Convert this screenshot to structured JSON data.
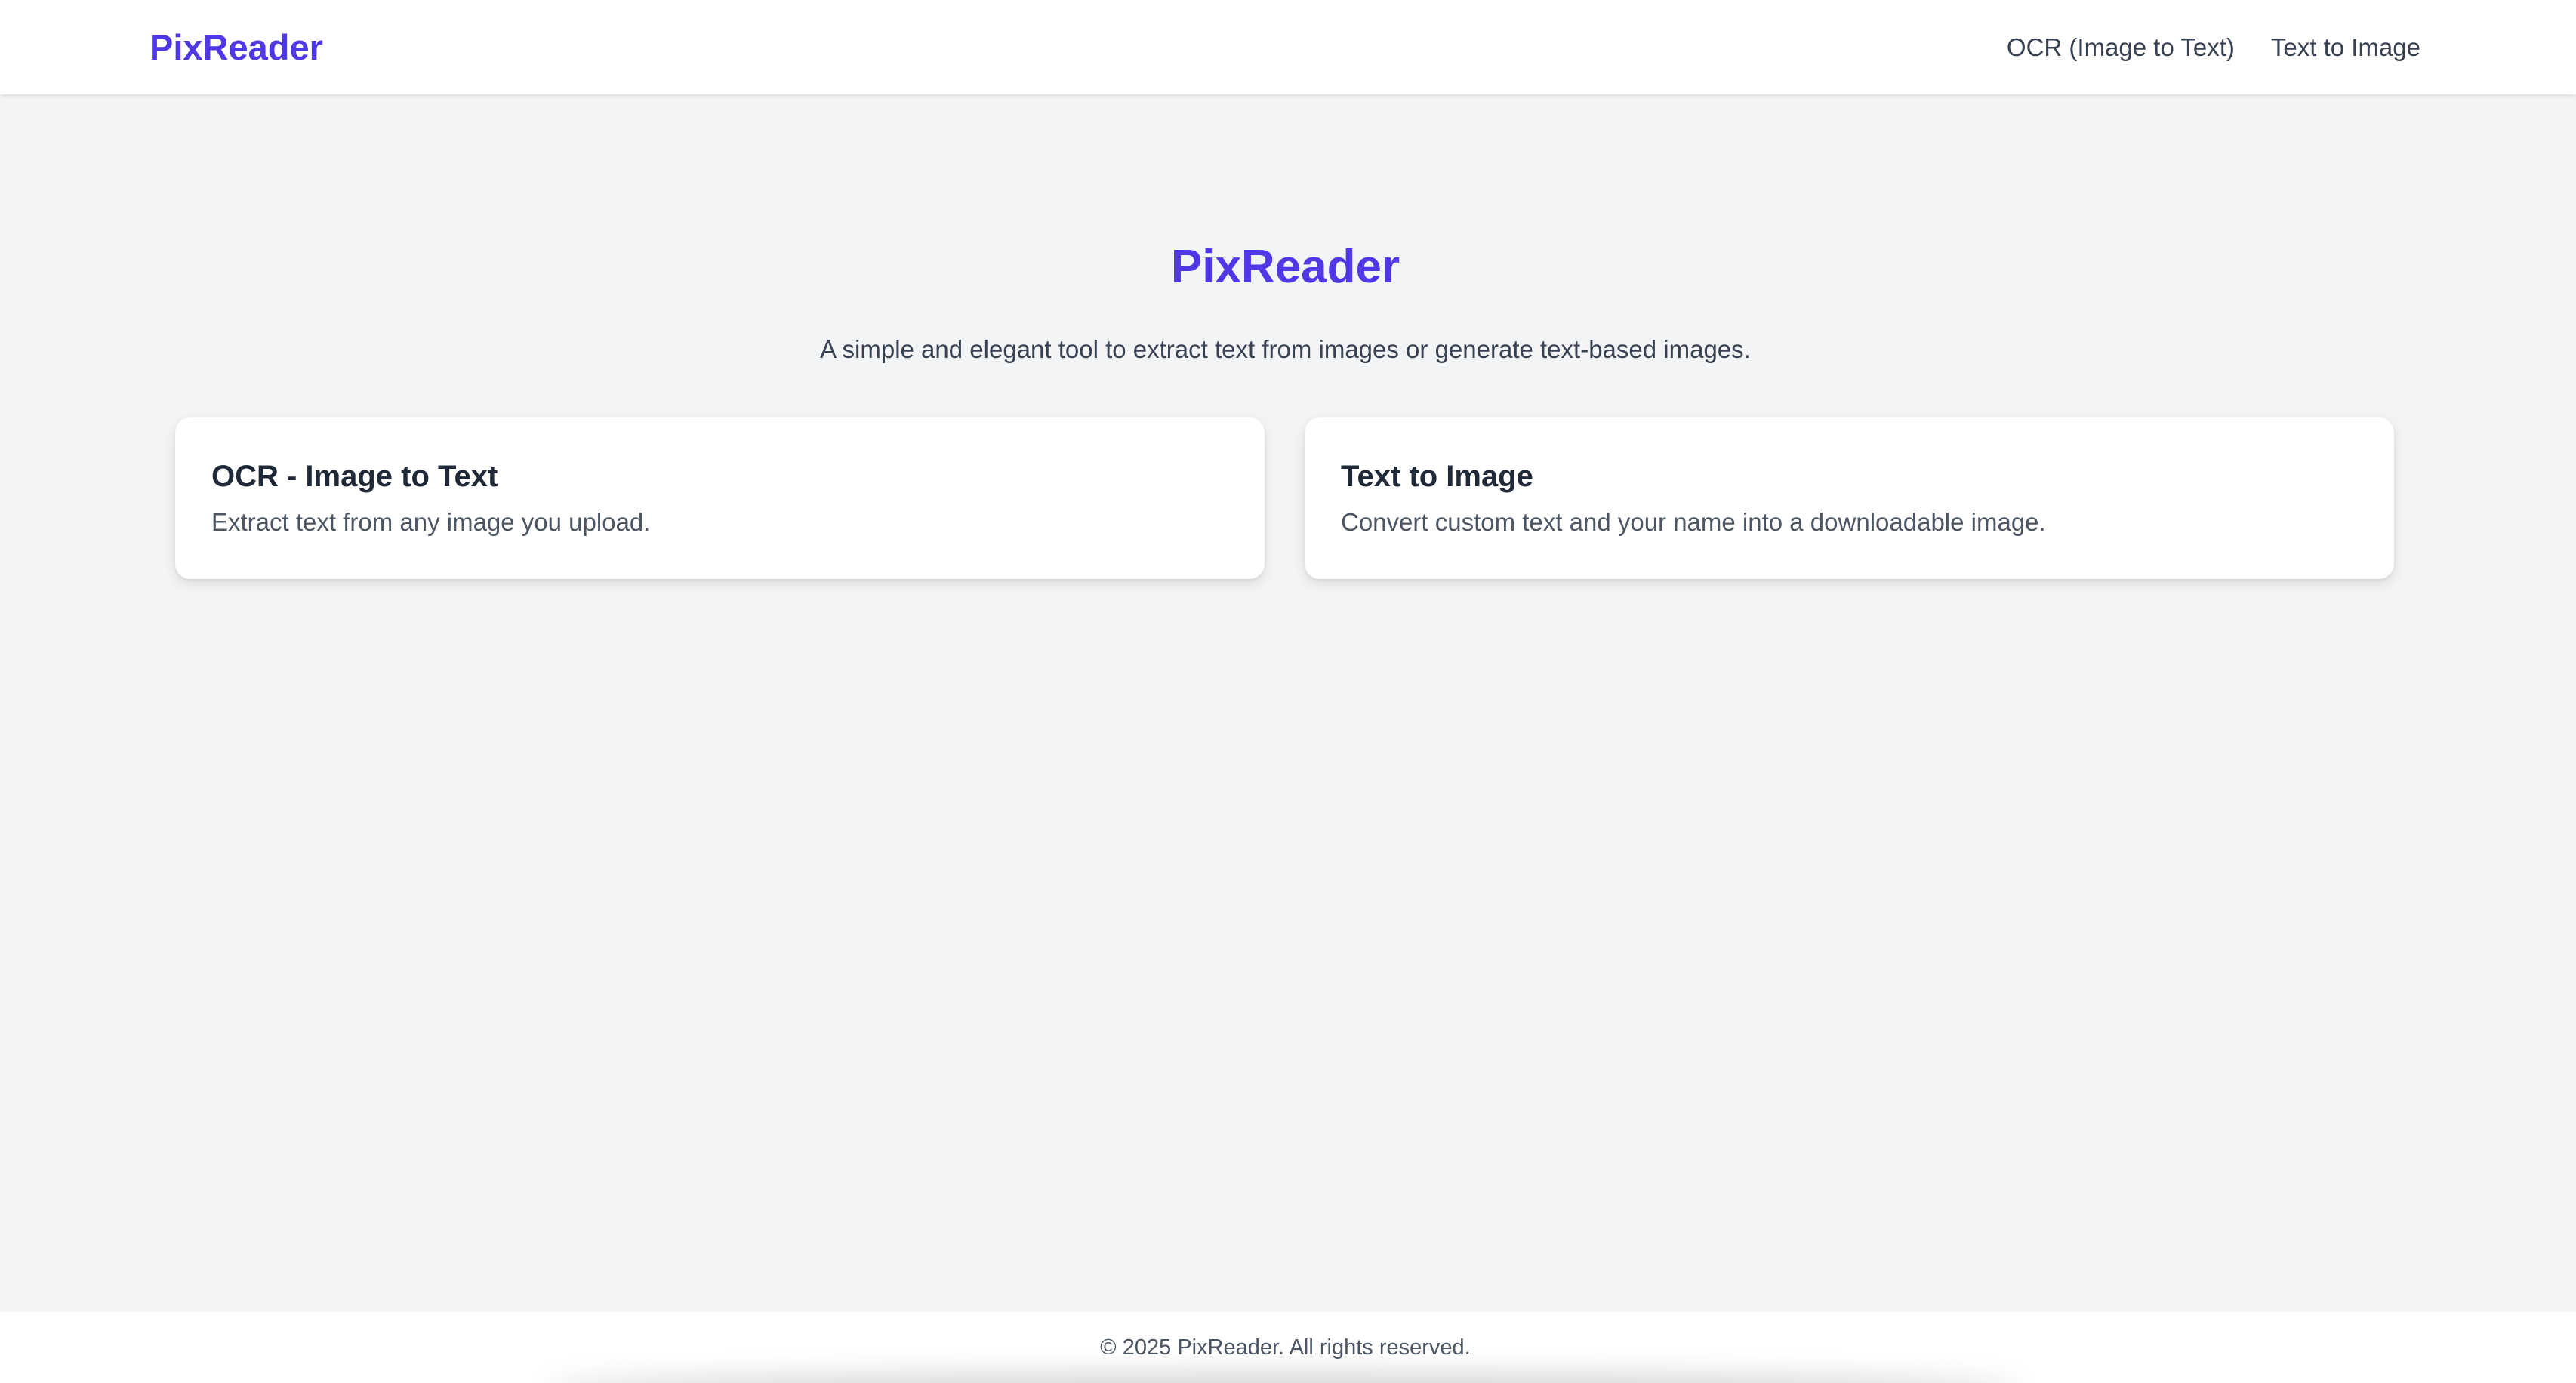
{
  "navbar": {
    "brand": "PixReader",
    "links": [
      {
        "label": "OCR (Image to Text)"
      },
      {
        "label": "Text to Image"
      }
    ]
  },
  "hero": {
    "title": "PixReader",
    "subtitle": "A simple and elegant tool to extract text from images or generate text-based images."
  },
  "cards": [
    {
      "title": "OCR - Image to Text",
      "description": "Extract text from any image you upload."
    },
    {
      "title": "Text to Image",
      "description": "Convert custom text and your name into a downloadable image."
    }
  ],
  "footer": {
    "text": "© 2025 PixReader. All rights reserved."
  },
  "colors": {
    "brand": "#4f39e6",
    "background": "#f3f4f6",
    "surface": "#ffffff",
    "text": "#374151"
  }
}
